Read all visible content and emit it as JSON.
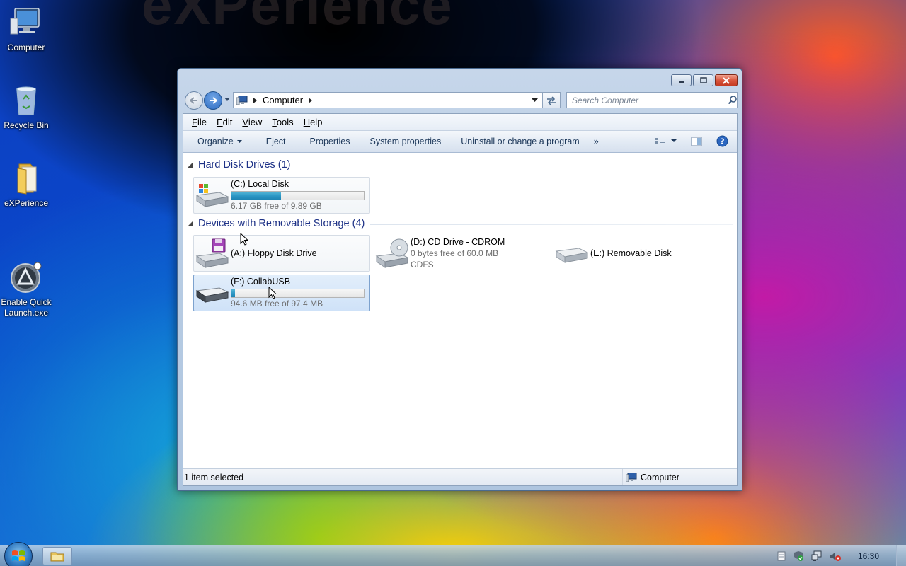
{
  "desktop": {
    "watermark": "eXPerience",
    "icons": [
      {
        "label": "Computer"
      },
      {
        "label": "Recycle Bin"
      },
      {
        "label": "eXPerience"
      },
      {
        "label": "Enable Quick\nLaunch.exe"
      }
    ]
  },
  "window": {
    "address": {
      "crumb": "Computer"
    },
    "search": {
      "placeholder": "Search Computer"
    },
    "menu": [
      "File",
      "Edit",
      "View",
      "Tools",
      "Help"
    ],
    "toolbar": {
      "organize": "Organize",
      "eject": "Eject",
      "properties": "Properties",
      "system_properties": "System properties",
      "uninstall": "Uninstall or change a program",
      "more": "»"
    },
    "groups": [
      {
        "title": "Hard Disk Drives (1)",
        "items": [
          {
            "name": "(C:) Local Disk",
            "free_text": "6.17 GB free of 9.89 GB",
            "used_fraction": 0.376
          }
        ]
      },
      {
        "title": "Devices with Removable Storage (4)",
        "items": [
          {
            "name": "(A:) Floppy Disk Drive"
          },
          {
            "name": "(D:) CD Drive - CDROM",
            "line2": "0 bytes free of 60.0 MB",
            "line3": "CDFS"
          },
          {
            "name": "(E:) Removable Disk"
          },
          {
            "name": "(F:) CollabUSB",
            "free_text": "94.6 MB free of 97.4 MB",
            "used_fraction": 0.029
          }
        ]
      }
    ],
    "status": {
      "selection": "1 item selected",
      "location": "Computer"
    }
  },
  "taskbar": {
    "clock": "16:30"
  },
  "colors": {
    "accent": "#1e3287",
    "bar_fill": "#2b96c4",
    "selection": "#cfe2f8"
  }
}
